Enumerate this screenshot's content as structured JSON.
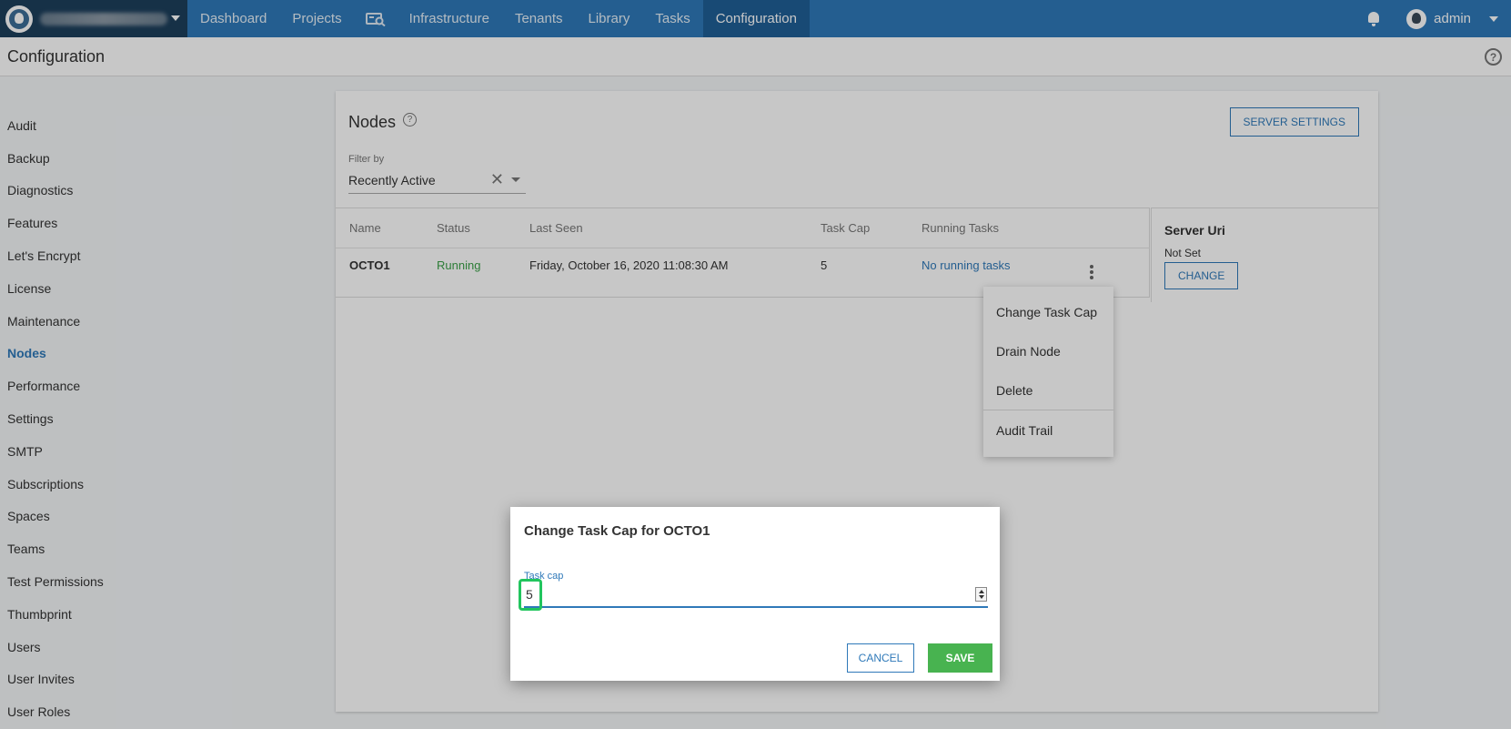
{
  "nav": {
    "items": [
      "Dashboard",
      "Projects",
      "Infrastructure",
      "Tenants",
      "Library",
      "Tasks",
      "Configuration"
    ],
    "user": "admin",
    "accent_color": "#2f79b9",
    "active_color": "#1f5f97"
  },
  "page": {
    "title": "Configuration"
  },
  "sidebar": {
    "items": [
      "Audit",
      "Backup",
      "Diagnostics",
      "Features",
      "Let's Encrypt",
      "License",
      "Maintenance",
      "Nodes",
      "Performance",
      "Settings",
      "SMTP",
      "Subscriptions",
      "Spaces",
      "Teams",
      "Test Permissions",
      "Thumbprint",
      "Users",
      "User Invites",
      "User Roles"
    ],
    "active": "Nodes"
  },
  "nodes": {
    "title": "Nodes",
    "server_settings_label": "SERVER SETTINGS",
    "filter_label": "Filter by",
    "filter_value": "Recently Active",
    "columns": [
      "Name",
      "Status",
      "Last Seen",
      "Task Cap",
      "Running Tasks"
    ],
    "rows": [
      {
        "name": "OCTO1",
        "status": "Running",
        "last_seen": "Friday, October 16, 2020 11:08:30 AM",
        "task_cap": "5",
        "running_tasks": "No running tasks"
      }
    ],
    "status_color": "#3aa047"
  },
  "server_uri": {
    "title": "Server Uri",
    "value": "Not Set",
    "change_label": "CHANGE"
  },
  "menu": {
    "items": [
      "Change Task Cap",
      "Drain Node",
      "Delete",
      "Audit Trail"
    ]
  },
  "modal": {
    "title": "Change Task Cap for OCTO1",
    "field_label": "Task cap",
    "field_value": "5",
    "cancel_label": "CANCEL",
    "save_label": "SAVE",
    "save_color": "#48b350"
  },
  "icons": [
    "logo-icon",
    "caret-down-icon",
    "search-card-icon",
    "bell-icon",
    "user-avatar-icon",
    "help-icon",
    "clear-icon",
    "kebab-icon"
  ]
}
